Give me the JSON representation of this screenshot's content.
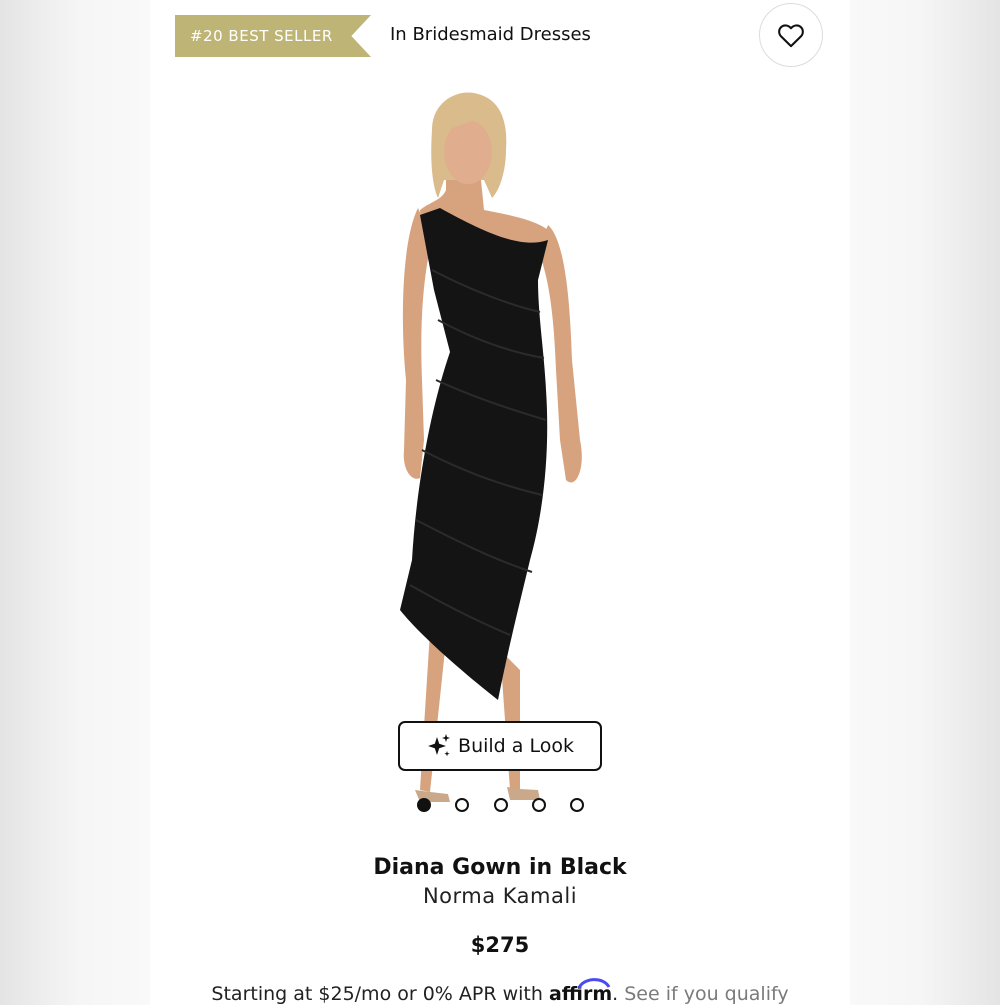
{
  "badge": {
    "text": "#20 BEST SELLER",
    "color": "#bdb476"
  },
  "category_text": "In Bridesmaid Dresses",
  "wishlist": {
    "icon": "heart-icon"
  },
  "build_look": {
    "icon": "sparkle-icon",
    "label": "Build a Look"
  },
  "carousel": {
    "count": 5,
    "active_index": 0
  },
  "product": {
    "name": "Diana Gown in Black",
    "brand": "Norma Kamali",
    "price": "$275"
  },
  "financing": {
    "prefix": "Starting at $25/mo or 0% APR with",
    "provider": "affirm",
    "link_text": "See if you qualify"
  }
}
